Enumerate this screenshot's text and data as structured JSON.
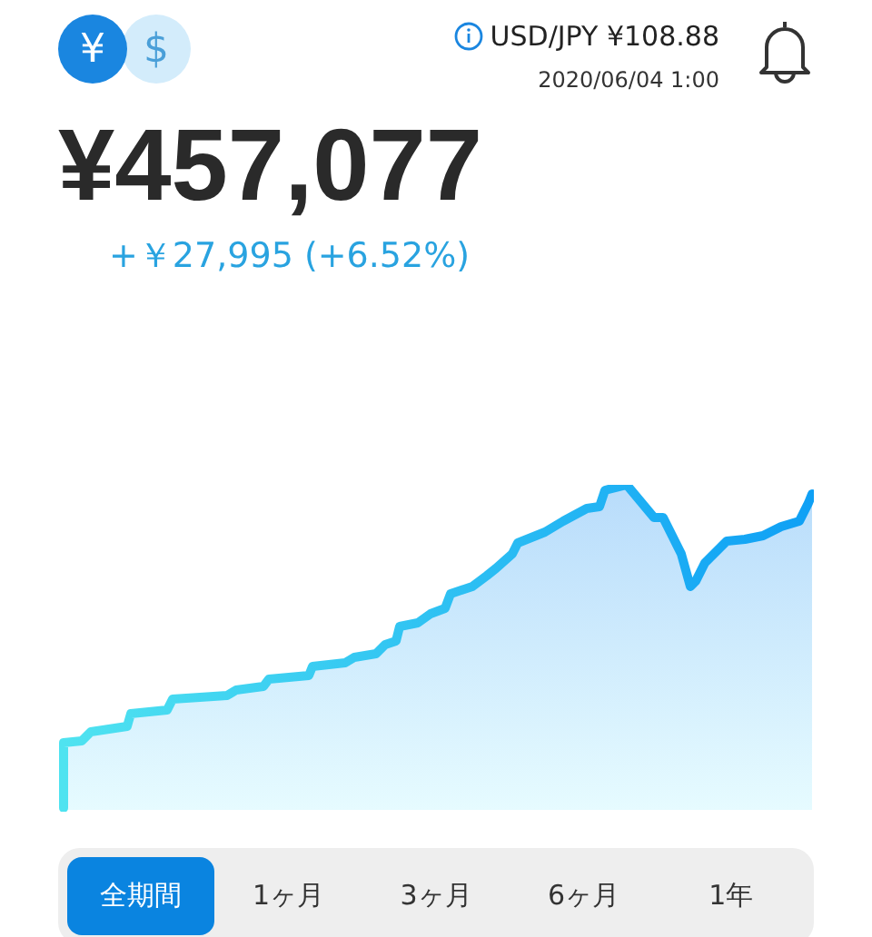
{
  "currency_toggle": [
    {
      "symbol": "¥",
      "selected": true
    },
    {
      "symbol": "$",
      "selected": false
    }
  ],
  "exchange_rate": {
    "label": "USD/JPY ¥108.88",
    "timestamp": "2020/06/04 1:00"
  },
  "balance": {
    "total": "¥457,077",
    "change": "+￥27,995 (+6.52%)"
  },
  "period_tabs": [
    {
      "label": "全期間",
      "selected": true
    },
    {
      "label": "1ヶ月",
      "selected": false
    },
    {
      "label": "3ヶ月",
      "selected": false
    },
    {
      "label": "6ヶ月",
      "selected": false
    },
    {
      "label": "1年",
      "selected": false
    }
  ]
}
